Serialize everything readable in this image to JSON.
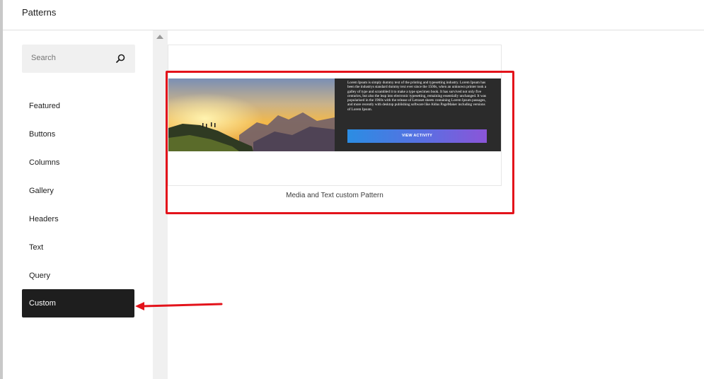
{
  "header": {
    "title": "Patterns"
  },
  "search": {
    "placeholder": "Search",
    "icon": "search-icon"
  },
  "categories": [
    {
      "label": "Featured",
      "active": false
    },
    {
      "label": "Buttons",
      "active": false
    },
    {
      "label": "Columns",
      "active": false
    },
    {
      "label": "Gallery",
      "active": false
    },
    {
      "label": "Headers",
      "active": false
    },
    {
      "label": "Text",
      "active": false
    },
    {
      "label": "Query",
      "active": false
    },
    {
      "label": "Custom",
      "active": true
    }
  ],
  "pattern": {
    "caption": "Media and Text custom Pattern",
    "preview_text": "Lorem Ipsum is simply dummy text of the printing and typesetting industry. Lorem Ipsum has been the industrys standard dummy text ever since the 1500s, when an unknown printer took a galley of type and scrambled it to make a type specimen book. It has survived not only five centuries, but also the leap into electronic typesetting, remaining essentially unchanged. It was popularised in the 1960s with the release of Letraset sheets containing Lorem Ipsum passages, and more recently with desktop publishing software like Aldus PageMaker including versions of Lorem Ipsum.",
    "button_label": "VIEW ACTIVITY"
  },
  "colors": {
    "active_bg": "#1e1e1e",
    "highlight": "#e3131b",
    "button_gradient_start": "#2b8de3",
    "button_gradient_end": "#8b55d8"
  }
}
